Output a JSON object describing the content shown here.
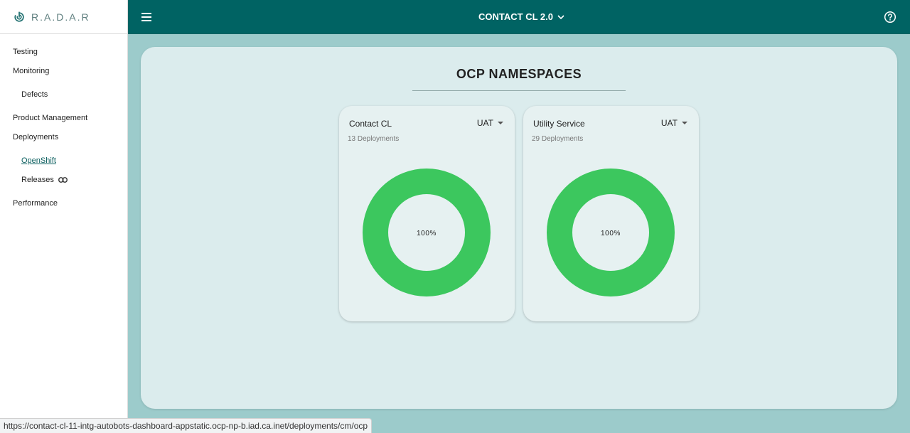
{
  "brand": {
    "name": "R.A.D.A.R",
    "icon": "radar-icon"
  },
  "header": {
    "app_name": "CONTACT CL 2.0",
    "help_icon": "help-icon"
  },
  "sidebar": {
    "items": [
      {
        "label": "Testing"
      },
      {
        "label": "Monitoring"
      },
      {
        "label": "Defects"
      },
      {
        "label": "Product Management"
      },
      {
        "label": "Deployments"
      },
      {
        "label": "OpenShift"
      },
      {
        "label": "Releases"
      },
      {
        "label": "Performance"
      }
    ]
  },
  "main": {
    "title": "OCP NAMESPACES",
    "cards": [
      {
        "name": "Contact CL",
        "environment": "UAT",
        "deployments": "13 Deployments",
        "percent_label": "100%",
        "percent": 100
      },
      {
        "name": "Utility Service",
        "environment": "UAT",
        "deployments": "29 Deployments",
        "percent_label": "100%",
        "percent": 100
      }
    ]
  },
  "status_bar": {
    "url": "https://contact-cl-11-intg-autobots-dashboard-appstatic.ocp-np-b.iad.ca.inet/deployments/cm/ocp"
  },
  "colors": {
    "header": "#006363",
    "background": "#9ccbcb",
    "card": "#dbeced",
    "donut": "#3cc75e"
  },
  "chart_data": [
    {
      "type": "pie",
      "title": "",
      "labels": [
        ""
      ],
      "values": [
        100
      ],
      "data_labels": [
        "100%"
      ]
    },
    {
      "type": "pie",
      "title": "",
      "labels": [
        ""
      ],
      "values": [
        100
      ],
      "data_labels": [
        "100%"
      ]
    }
  ]
}
